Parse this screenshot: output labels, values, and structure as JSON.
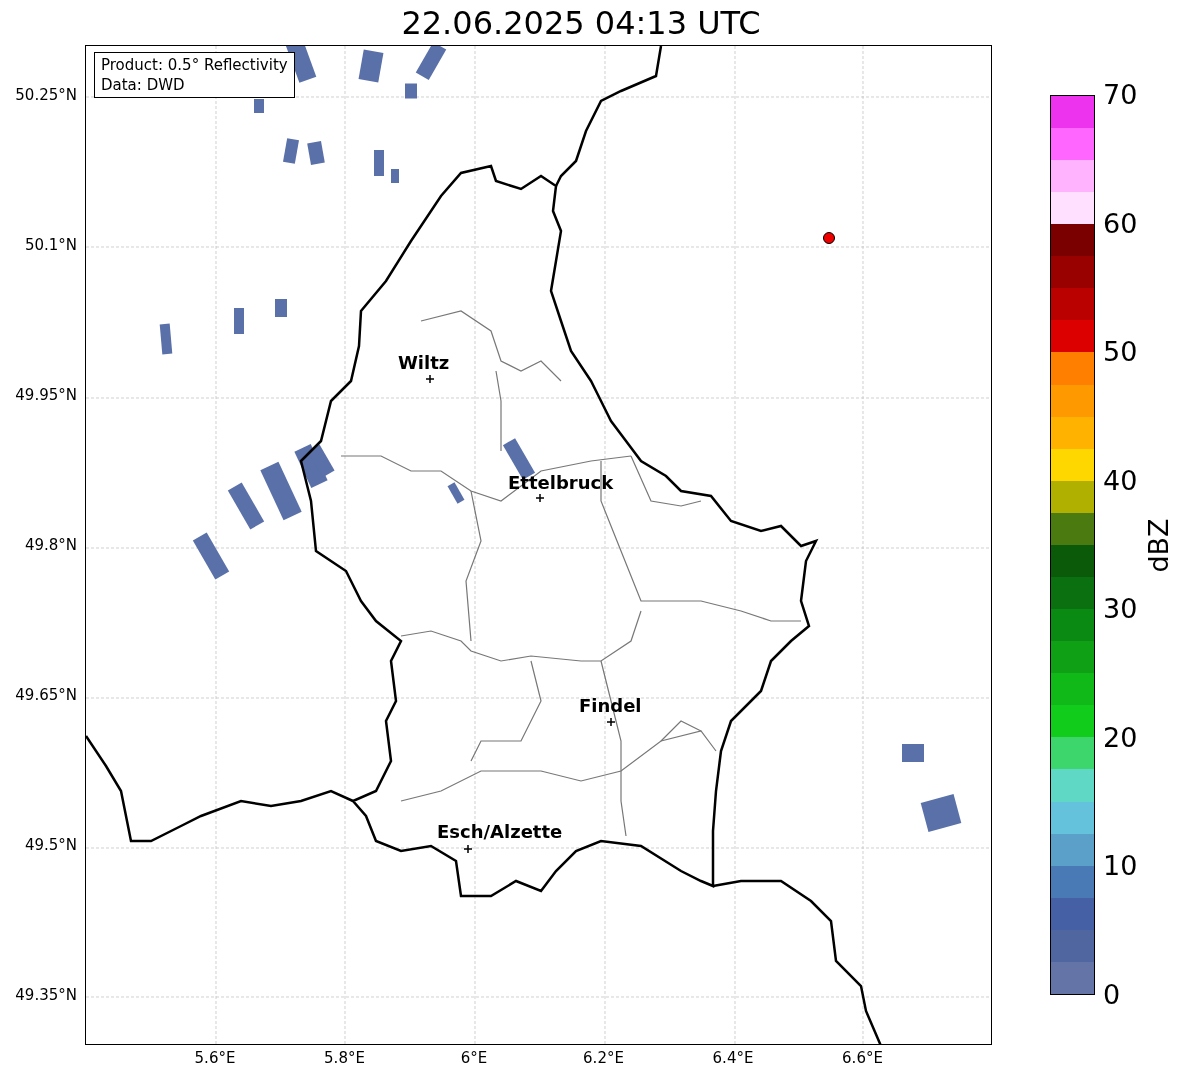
{
  "title": "22.06.2025 04:13 UTC",
  "map": {
    "legend": [
      "Product: 0.5° Reflectivity",
      "Data: DWD"
    ],
    "yticks": [
      "50.25°N",
      "50.1°N",
      "49.95°N",
      "49.8°N",
      "49.65°N",
      "49.5°N",
      "49.35°N"
    ],
    "xticks": [
      "5.6°E",
      "5.8°E",
      "6°E",
      "6.2°E",
      "6.4°E",
      "6.6°E"
    ],
    "cities": [
      {
        "name": "Wiltz"
      },
      {
        "name": "Ettelbruck"
      },
      {
        "name": "Findel"
      },
      {
        "name": "Esch/Alzette"
      }
    ]
  },
  "colorbar": {
    "label": "dBZ",
    "ticks": [
      "70",
      "60",
      "50",
      "40",
      "30",
      "20",
      "10",
      "0"
    ],
    "bands": [
      {
        "color": "#6474a6"
      },
      {
        "color": "#5066a0"
      },
      {
        "color": "#4660a6"
      },
      {
        "color": "#4a7ab5"
      },
      {
        "color": "#5aa0c8"
      },
      {
        "color": "#64c2dc"
      },
      {
        "color": "#5fd8c6"
      },
      {
        "color": "#3dd66c"
      },
      {
        "color": "#12cc1c"
      },
      {
        "color": "#10b818"
      },
      {
        "color": "#0fa015"
      },
      {
        "color": "#0b8a13"
      },
      {
        "color": "#0a7010"
      },
      {
        "color": "#0a5a0a"
      },
      {
        "color": "#4a7a10"
      },
      {
        "color": "#b0b000"
      },
      {
        "color": "#ffd700"
      },
      {
        "color": "#ffb300"
      },
      {
        "color": "#ff9900"
      },
      {
        "color": "#ff7f00"
      },
      {
        "color": "#dd0000"
      },
      {
        "color": "#bb0000"
      },
      {
        "color": "#990000"
      },
      {
        "color": "#7a0000"
      },
      {
        "color": "#ffe0ff"
      },
      {
        "color": "#ffb3ff"
      },
      {
        "color": "#ff66ff"
      },
      {
        "color": "#ee33ee"
      }
    ]
  }
}
